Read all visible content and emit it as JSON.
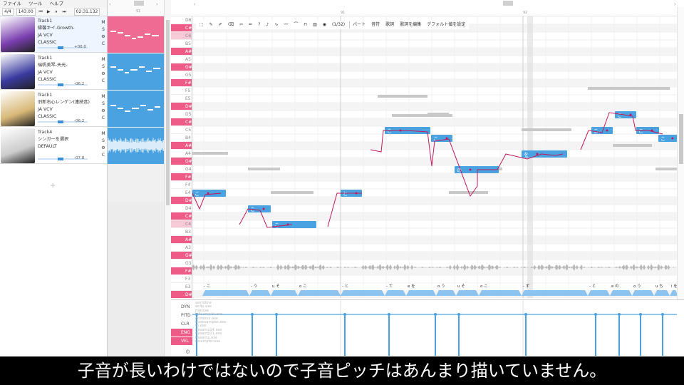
{
  "menu": [
    "ファイル",
    "ツール",
    "ヘルプ"
  ],
  "transport": {
    "time_sig": "4/4",
    "tempo": "143.00",
    "time": "02:31.132"
  },
  "tracks": [
    {
      "name": "Track1",
      "song": "縁馨キイ-Growth-",
      "lang": "JA VCV",
      "style": "CLASSIC",
      "vol": "+00.0",
      "m": "M",
      "s": "S",
      "c": "C",
      "color": "#7a3fb0"
    },
    {
      "name": "Track1",
      "song": "瑞帆美琴-天光-",
      "lang": "JA VCV",
      "style": "CLASSIC",
      "vol": "-06.2",
      "m": "M",
      "s": "S",
      "c": "C",
      "color": "#3a3aa0"
    },
    {
      "name": "Track1",
      "song": "旧新右心レンゲン(連続音)",
      "lang": "JA VCV",
      "style": "CLASSIC",
      "vol": "-06.2",
      "m": "M",
      "s": "S",
      "c": "C",
      "color": "#d8b878"
    },
    {
      "name": "Track4",
      "song": "シンガーを選択",
      "lang": "",
      "style": "DEFAULT",
      "vol": "-07.8",
      "m": "M",
      "s": "S",
      "c": "C",
      "color": "#cccccc"
    }
  ],
  "add_track": "+",
  "ruler": {
    "marks": [
      "91",
      "92"
    ]
  },
  "keys": [
    "D6",
    "C#6",
    "C6",
    "B5",
    "A#5",
    "A5",
    "G#5",
    "G5",
    "F#5",
    "F5",
    "E5",
    "D#5",
    "D5",
    "C#5",
    "C5",
    "B4",
    "A#4",
    "A4",
    "G#4",
    "G4",
    "F#4",
    "F4",
    "E4",
    "D#4",
    "D4",
    "C#4",
    "C4",
    "B3",
    "A#3",
    "A3",
    "G#3",
    "G3",
    "F#3",
    "F3",
    "E3",
    "D#3"
  ],
  "toolbar": {
    "page": "(1/32)",
    "items": [
      "パート",
      "音符",
      "歌詞",
      "歌詞を編集",
      "デフォルト値を設定"
    ]
  },
  "phonemes": [
    "- こ",
    "- う",
    "u そ",
    "o こ",
    "- と",
    "- て",
    "e を",
    "o う",
    "u そ",
    "o こ",
    "- ず",
    "- と",
    "e の",
    "o う",
    "u ち",
    "i を"
  ],
  "note_lyrics": [
    "こ",
    "と",
    "の",
    "を"
  ],
  "param_labels": [
    "DYN",
    "PITD",
    "CLR",
    "ENG",
    "VEL"
  ],
  "param_list": [
    "worldline",
    "wr4u.exe",
    "mw.exe",
    "hifisampler.exe",
    "phinonix.exe",
    "moresampler.exe",
    "tn.exe",
    "fresamp14.exe",
    "fresamp11.exe",
    "fresamp.exe",
    "resampler.exe"
  ],
  "subtitle": "子音が長いわけではないので子音ピッチはあんまり描いていません。",
  "colors": {
    "accent": "#ef5b87",
    "note": "#4aa3e0",
    "pitch": "#c2185b"
  }
}
